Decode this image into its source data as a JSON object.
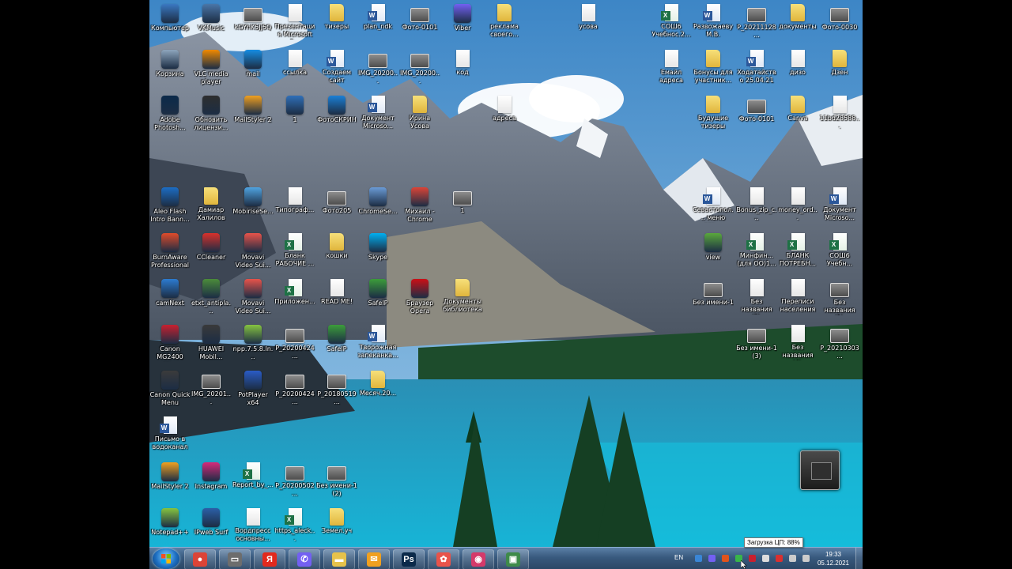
{
  "desktop": {
    "icons": [
      {
        "label": "Компьютер",
        "icon": "computer-icon",
        "kind": "app",
        "color": "#3a78c2"
      },
      {
        "label": "VKMusic",
        "icon": "vkmusic-icon",
        "kind": "app",
        "color": "#4a76a8"
      },
      {
        "label": "kGYhK5Jj5Q",
        "icon": "image-file-icon",
        "kind": "photo"
      },
      {
        "label": "Презентация Microsoft P...",
        "icon": "presentation-icon",
        "kind": "doc"
      },
      {
        "label": "тизеры",
        "icon": "folder-icon",
        "kind": "folder"
      },
      {
        "label": "plan_ndk",
        "icon": "word-doc-icon",
        "kind": "word"
      },
      {
        "label": "Фото-0101",
        "icon": "image-file-icon",
        "kind": "photo"
      },
      {
        "label": "Viber",
        "icon": "viber-icon",
        "kind": "app",
        "color": "#7360f2"
      },
      {
        "label": "реклама своего...",
        "icon": "folder-icon",
        "kind": "folder"
      },
      {
        "label": "усова",
        "icon": "text-file-icon",
        "kind": "doc"
      },
      {
        "label": "СОШ6 Учебнос.2...",
        "icon": "excel-doc-icon",
        "kind": "excel"
      },
      {
        "label": "Развожаеву М.В.",
        "icon": "word-doc-icon",
        "kind": "word"
      },
      {
        "label": "P_20211128...",
        "icon": "image-file-icon",
        "kind": "photo"
      },
      {
        "label": "документы",
        "icon": "folder-icon",
        "kind": "folder"
      },
      {
        "label": "Фото-0030",
        "icon": "image-file-icon",
        "kind": "photo"
      },
      {
        "label": "Корзина",
        "icon": "recycle-bin-icon",
        "kind": "app",
        "color": "#8ea6bd"
      },
      {
        "label": "VLC media player",
        "icon": "vlc-icon",
        "kind": "app",
        "color": "#f08a00"
      },
      {
        "label": "mail",
        "icon": "mail-icon",
        "kind": "app",
        "color": "#168de2"
      },
      {
        "label": "ссылка",
        "icon": "text-file-icon",
        "kind": "doc"
      },
      {
        "label": "Создаем сайт",
        "icon": "word-doc-icon",
        "kind": "word"
      },
      {
        "label": "IMG_20200...",
        "icon": "image-file-icon",
        "kind": "photo"
      },
      {
        "label": "IMG_20200...",
        "icon": "image-file-icon",
        "kind": "photo"
      },
      {
        "label": "код",
        "icon": "text-file-icon",
        "kind": "doc"
      },
      {
        "label": "Емайл адреса",
        "icon": "text-file-icon",
        "kind": "doc"
      },
      {
        "label": "Бонусы для участник...",
        "icon": "folder-icon",
        "kind": "folder"
      },
      {
        "label": "Ходатайство 25.04.21 н...",
        "icon": "word-doc-icon",
        "kind": "word"
      },
      {
        "label": "дизо",
        "icon": "text-file-icon",
        "kind": "doc"
      },
      {
        "label": "Дзен",
        "icon": "folder-icon",
        "kind": "folder"
      },
      {
        "label": "Adobe Photosh...",
        "icon": "photoshop-icon",
        "kind": "app",
        "color": "#0b2a4a"
      },
      {
        "label": "Обновить лицензи...",
        "icon": "update-icon",
        "kind": "app",
        "color": "#2e2e2e"
      },
      {
        "label": "MailStyler 2",
        "icon": "mailstyler-icon",
        "kind": "app",
        "color": "#f0a020"
      },
      {
        "label": "1",
        "icon": "shortcut-icon",
        "kind": "app",
        "color": "#2f6fb8"
      },
      {
        "label": "ФотоСКРИН",
        "icon": "fotoscreen-icon",
        "kind": "app",
        "color": "#1a7fd6"
      },
      {
        "label": "Документ Microso...",
        "icon": "word-doc-icon",
        "kind": "word"
      },
      {
        "label": "Ирина Усова",
        "icon": "folder-icon",
        "kind": "folder"
      },
      {
        "label": "адреса",
        "icon": "text-file-icon",
        "kind": "doc"
      },
      {
        "label": "Будущие тизеры",
        "icon": "folder-icon",
        "kind": "folder"
      },
      {
        "label": "Фото-0101",
        "icon": "image-file-icon",
        "kind": "photo"
      },
      {
        "label": "Canva",
        "icon": "folder-icon",
        "kind": "folder"
      },
      {
        "label": "11bd28588...",
        "icon": "text-file-icon",
        "kind": "doc"
      },
      {
        "label": "Aleo Flash Intro Bann...",
        "icon": "aleo-icon",
        "kind": "app",
        "color": "#1c6dc4"
      },
      {
        "label": "Дамиар Халилов",
        "icon": "folder-icon",
        "kind": "folder"
      },
      {
        "label": "MobiriseSe...",
        "icon": "mobirise-icon",
        "kind": "app",
        "color": "#4fa3e0"
      },
      {
        "label": "Типограф...",
        "icon": "text-file-icon",
        "kind": "doc"
      },
      {
        "label": "Фото205",
        "icon": "image-file-icon",
        "kind": "photo"
      },
      {
        "label": "ChromeSe...",
        "icon": "chrome-setup-icon",
        "kind": "app",
        "color": "#6a9bd6"
      },
      {
        "label": "Михаил - Chrome",
        "icon": "chrome-icon",
        "kind": "app",
        "color": "#db4437"
      },
      {
        "label": "1",
        "icon": "image-file-icon",
        "kind": "photo"
      },
      {
        "label": "Севастопол... меню гла...",
        "icon": "word-doc-icon",
        "kind": "word"
      },
      {
        "label": "Bonus_zip_c...",
        "icon": "archive-icon",
        "kind": "doc"
      },
      {
        "label": "money_ord...",
        "icon": "text-file-icon",
        "kind": "doc"
      },
      {
        "label": "Документ Microso...",
        "icon": "word-doc-icon",
        "kind": "word"
      },
      {
        "label": "BurnAware Professional",
        "icon": "burnaware-icon",
        "kind": "app",
        "color": "#e04b2a"
      },
      {
        "label": "CCleaner",
        "icon": "ccleaner-icon",
        "kind": "app",
        "color": "#d9312b"
      },
      {
        "label": "Movavi Video Sui...",
        "icon": "movavi-icon",
        "kind": "app",
        "color": "#e8534a"
      },
      {
        "label": "Бланк РАБОЧИЕ ...",
        "icon": "excel-doc-icon",
        "kind": "excel"
      },
      {
        "label": "кошки",
        "icon": "folder-icon",
        "kind": "folder"
      },
      {
        "label": "Skype",
        "icon": "skype-icon",
        "kind": "app",
        "color": "#00aff0"
      },
      {
        "label": "view",
        "icon": "view-icon",
        "kind": "app",
        "color": "#5aa83c"
      },
      {
        "label": "Минфин... (для ОО)1...",
        "icon": "excel-doc-icon",
        "kind": "excel"
      },
      {
        "label": "БЛАНК ПОТРЕБН...",
        "icon": "excel-doc-icon",
        "kind": "excel"
      },
      {
        "label": "СОШ6 Учебн...",
        "icon": "excel-doc-icon",
        "kind": "excel"
      },
      {
        "label": "camNext",
        "icon": "camnext-icon",
        "kind": "app",
        "color": "#2c7bd0"
      },
      {
        "label": "etxt_antipla...",
        "icon": "etxt-icon",
        "kind": "app",
        "color": "#4b8c3a"
      },
      {
        "label": "Movavi Video Sui...",
        "icon": "movavi-icon",
        "kind": "app",
        "color": "#e8534a"
      },
      {
        "label": "Приложен...",
        "icon": "excel-doc-icon",
        "kind": "excel"
      },
      {
        "label": "READ ME!",
        "icon": "text-file-icon",
        "kind": "doc"
      },
      {
        "label": "SafeIP",
        "icon": "safeip-icon",
        "kind": "app",
        "color": "#3c9d3a"
      },
      {
        "label": "Браузер Opera",
        "icon": "opera-icon",
        "kind": "app",
        "color": "#cc0f16"
      },
      {
        "label": "Документы библиотека",
        "icon": "folder-icon",
        "kind": "folder"
      },
      {
        "label": "Без имени-1",
        "icon": "image-file-icon",
        "kind": "photo"
      },
      {
        "label": "Без названия (2)",
        "icon": "image-file-icon",
        "kind": "doc"
      },
      {
        "label": "Переписи населения",
        "icon": "text-file-icon",
        "kind": "doc"
      },
      {
        "label": "Без названия (1)",
        "icon": "image-file-icon",
        "kind": "photo"
      },
      {
        "label": "Canon MG2400 se...",
        "icon": "canon-icon",
        "kind": "app",
        "color": "#c8202f"
      },
      {
        "label": "HUAWEI Mobil...",
        "icon": "huawei-icon",
        "kind": "app",
        "color": "#3a3a3a"
      },
      {
        "label": "npp.7.5.8.In...",
        "icon": "notepadpp-icon",
        "kind": "app",
        "color": "#86c440"
      },
      {
        "label": "P_20200424...",
        "icon": "image-file-icon",
        "kind": "photo"
      },
      {
        "label": "SafeIP",
        "icon": "safeip-icon",
        "kind": "app",
        "color": "#3c9d3a"
      },
      {
        "label": "Творожная запеканка...",
        "icon": "word-doc-icon",
        "kind": "word"
      },
      {
        "label": "Без имени-1 (3)",
        "icon": "image-file-icon",
        "kind": "photo"
      },
      {
        "label": "Без названия (4)",
        "icon": "image-file-icon",
        "kind": "doc"
      },
      {
        "label": "P_20210303...",
        "icon": "image-file-icon",
        "kind": "photo"
      },
      {
        "label": "Canon Quick Menu",
        "icon": "canon-quick-icon",
        "kind": "app",
        "color": "#3b3b3b"
      },
      {
        "label": "IMG_20201...",
        "icon": "image-file-icon",
        "kind": "photo"
      },
      {
        "label": "PotPlayer x64",
        "icon": "potplayer-icon",
        "kind": "app",
        "color": "#2a5cc7"
      },
      {
        "label": "P_20200424...",
        "icon": "image-file-icon",
        "kind": "photo"
      },
      {
        "label": "P_20180519...",
        "icon": "image-file-icon",
        "kind": "photo"
      },
      {
        "label": "Месяч.20...",
        "icon": "folder-icon",
        "kind": "folder"
      },
      {
        "label": "Письмо в водоканал",
        "icon": "word-doc-icon",
        "kind": "word"
      },
      {
        "label": "MailStyler 2",
        "icon": "mailstyler-icon",
        "kind": "app",
        "color": "#f0a020"
      },
      {
        "label": "Instagram",
        "icon": "instagram-icon",
        "kind": "app",
        "color": "#d6297a"
      },
      {
        "label": "Report_by_...",
        "icon": "excel-doc-icon",
        "kind": "excel"
      },
      {
        "label": "P_20200502...",
        "icon": "image-file-icon",
        "kind": "photo"
      },
      {
        "label": "Без имени-1 (2)",
        "icon": "image-file-icon",
        "kind": "photo"
      },
      {
        "label": "Notepad++",
        "icon": "notepadpp-icon",
        "kind": "app",
        "color": "#86c440"
      },
      {
        "label": "IPweb Surf",
        "icon": "ipweb-icon",
        "kind": "app",
        "color": "#2b5fa8"
      },
      {
        "label": "Вордпресс основны...",
        "icon": "text-file-icon",
        "kind": "doc"
      },
      {
        "label": "https_aleck...",
        "icon": "excel-doc-icon",
        "kind": "excel"
      },
      {
        "label": "Земел.уч",
        "icon": "folder-icon",
        "kind": "folder"
      }
    ]
  },
  "taskbar": {
    "start_icon": "windows-start-icon",
    "pinned": [
      {
        "name": "chrome",
        "icon": "chrome-icon",
        "glyph": "●",
        "color": "#db4437"
      },
      {
        "name": "file-explorer-window",
        "icon": "window-icon",
        "glyph": "▭",
        "color": "#6d6d6d"
      },
      {
        "name": "yandex-browser",
        "icon": "yandex-icon",
        "glyph": "Я",
        "color": "#e22a1e"
      },
      {
        "name": "viber",
        "icon": "viber-icon",
        "glyph": "✆",
        "color": "#7360f2"
      },
      {
        "name": "folders",
        "icon": "folder-icon",
        "glyph": "▬",
        "color": "#e6c24b"
      },
      {
        "name": "mailstyler",
        "icon": "mailstyler-icon",
        "glyph": "✉",
        "color": "#f0a020"
      },
      {
        "name": "photoshop",
        "icon": "photoshop-icon",
        "glyph": "Ps",
        "color": "#0b2a4a"
      },
      {
        "name": "movavi",
        "icon": "movavi-icon",
        "glyph": "✿",
        "color": "#e8534a"
      },
      {
        "name": "screen-recorder",
        "icon": "screen-recorder-icon",
        "glyph": "◉",
        "color": "#d43a6a"
      },
      {
        "name": "game-app",
        "icon": "game-icon",
        "glyph": "▣",
        "color": "#3e8a4a"
      }
    ],
    "language": "EN",
    "clock_time": "19:33",
    "clock_date": "05.12.2021",
    "tray": [
      {
        "name": "tray-network",
        "icon": "network-icon",
        "color": "#3a86d6"
      },
      {
        "name": "tray-viber",
        "icon": "viber-icon",
        "color": "#7360f2"
      },
      {
        "name": "tray-alert",
        "icon": "alert-icon",
        "color": "#e0531c"
      },
      {
        "name": "tray-cpu",
        "icon": "cpu-icon",
        "color": "#39b54a"
      },
      {
        "name": "tray-recorder",
        "icon": "recorder-icon",
        "color": "#c8202f"
      },
      {
        "name": "tray-volume",
        "icon": "volume-icon",
        "color": "#dddddd"
      },
      {
        "name": "tray-shield",
        "icon": "shield-icon",
        "color": "#d93030"
      },
      {
        "name": "tray-display",
        "icon": "display-icon",
        "color": "#cccccc"
      },
      {
        "name": "tray-power",
        "icon": "power-icon",
        "color": "#cccccc"
      }
    ]
  },
  "tooltip": {
    "text": "Загрузка ЦП: 88%"
  },
  "colors": {
    "sky_top": "#3d86c6",
    "lake": "#1fa6c9",
    "forest": "#1d4c2c",
    "taskbar": "#38597d"
  }
}
